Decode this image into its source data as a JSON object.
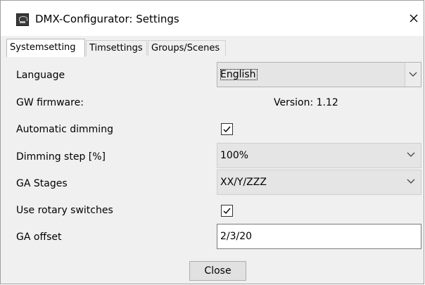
{
  "window": {
    "title": "DMX-Configurator: Settings",
    "icon": "app-settings-icon",
    "close_glyph": "✕"
  },
  "tabs": [
    {
      "label": "Systemsetting",
      "active": true
    },
    {
      "label": "Timsettings",
      "active": false
    },
    {
      "label": "Groups/Scenes",
      "active": false
    }
  ],
  "settings": {
    "language": {
      "label": "Language",
      "value": "English"
    },
    "gw_firmware": {
      "label": "GW firmware:",
      "value": "Version: 1.12"
    },
    "automatic_dimming": {
      "label": "Automatic dimming",
      "checked": true
    },
    "dimming_step": {
      "label": "Dimming step [%]",
      "value": "100%"
    },
    "ga_stages": {
      "label": "GA Stages",
      "value": "XX/Y/ZZZ"
    },
    "rotary_switches": {
      "label": "Use rotary switches",
      "checked": true
    },
    "ga_offset": {
      "label": "GA offset",
      "value": "2/3/20"
    }
  },
  "footer": {
    "close_label": "Close"
  }
}
